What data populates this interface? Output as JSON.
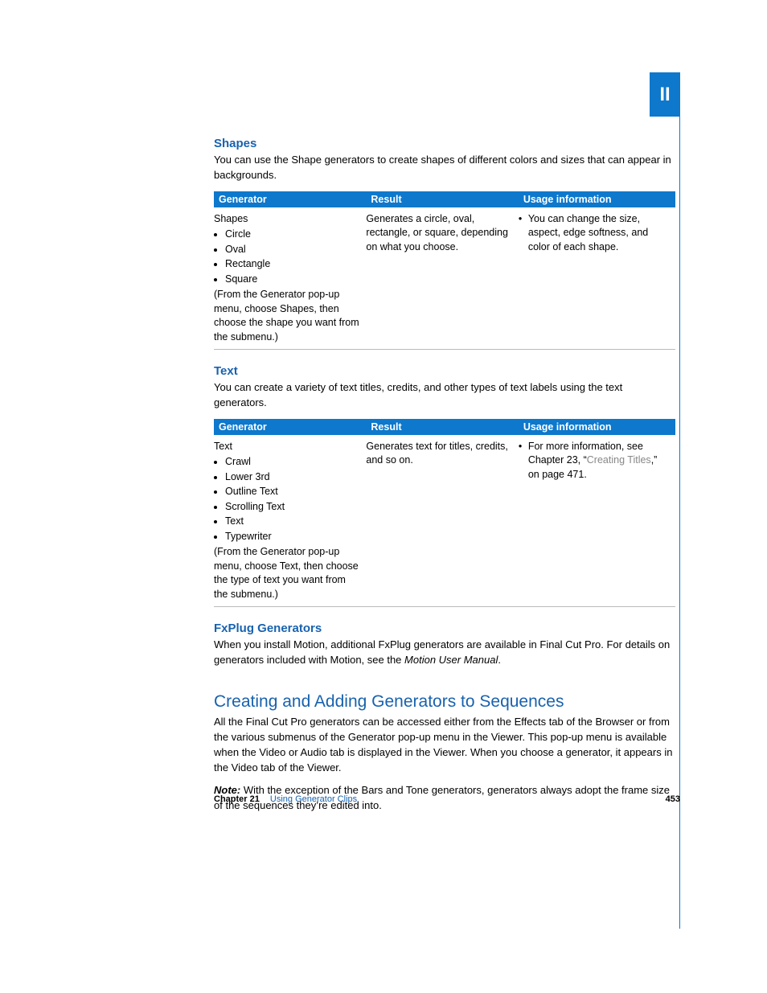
{
  "side_tab": "II",
  "sections": {
    "shapes": {
      "heading": "Shapes",
      "intro": "You can use the Shape generators to create shapes of different colors and sizes that can appear in backgrounds.",
      "table": {
        "headers": [
          "Generator",
          "Result",
          "Usage information"
        ],
        "row": {
          "generator_title": "Shapes",
          "generator_items": [
            "Circle",
            "Oval",
            "Rectangle",
            "Square"
          ],
          "generator_note": "(From the Generator pop-up menu, choose Shapes, then choose the shape you want from the submenu.)",
          "result": "Generates a circle, oval, rectangle, or square, depending on what you choose.",
          "usage": "You can change the size, aspect, edge softness, and color of each shape."
        }
      }
    },
    "text": {
      "heading": "Text",
      "intro": "You can create a variety of text titles, credits, and other types of text labels using the text generators.",
      "table": {
        "headers": [
          "Generator",
          "Result",
          "Usage information"
        ],
        "row": {
          "generator_title": "Text",
          "generator_items": [
            "Crawl",
            "Lower 3rd",
            "Outline Text",
            "Scrolling Text",
            "Text",
            "Typewriter"
          ],
          "generator_note": "(From the Generator pop-up menu, choose Text, then choose the type of text you want from the submenu.)",
          "result": "Generates text for titles, credits, and so on.",
          "usage_pre": "For more information, see Chapter 23, “",
          "usage_link": "Creating Titles",
          "usage_post": ",” on page 471."
        }
      }
    },
    "fxplug": {
      "heading": "FxPlug Generators",
      "intro_pre": "When you install Motion, additional FxPlug generators are available in Final Cut Pro. For details on generators included with Motion, see the ",
      "intro_em": "Motion User Manual",
      "intro_post": "."
    },
    "creating": {
      "heading": "Creating and Adding Generators to Sequences",
      "p1": "All the Final Cut Pro generators can be accessed either from the Effects tab of the Browser or from the various submenus of the Generator pop-up menu in the Viewer. This pop-up menu is available when the Video or Audio tab is displayed in the Viewer. When you choose a generator, it appears in the Video tab of the Viewer.",
      "note_label": "Note:",
      "note_body": "  With the exception of the Bars and Tone generators, generators always adopt the frame size of the sequences they’re edited into."
    }
  },
  "footer": {
    "chapter_label": "Chapter 21",
    "chapter_name": "Using Generator Clips",
    "page_number": "453"
  }
}
